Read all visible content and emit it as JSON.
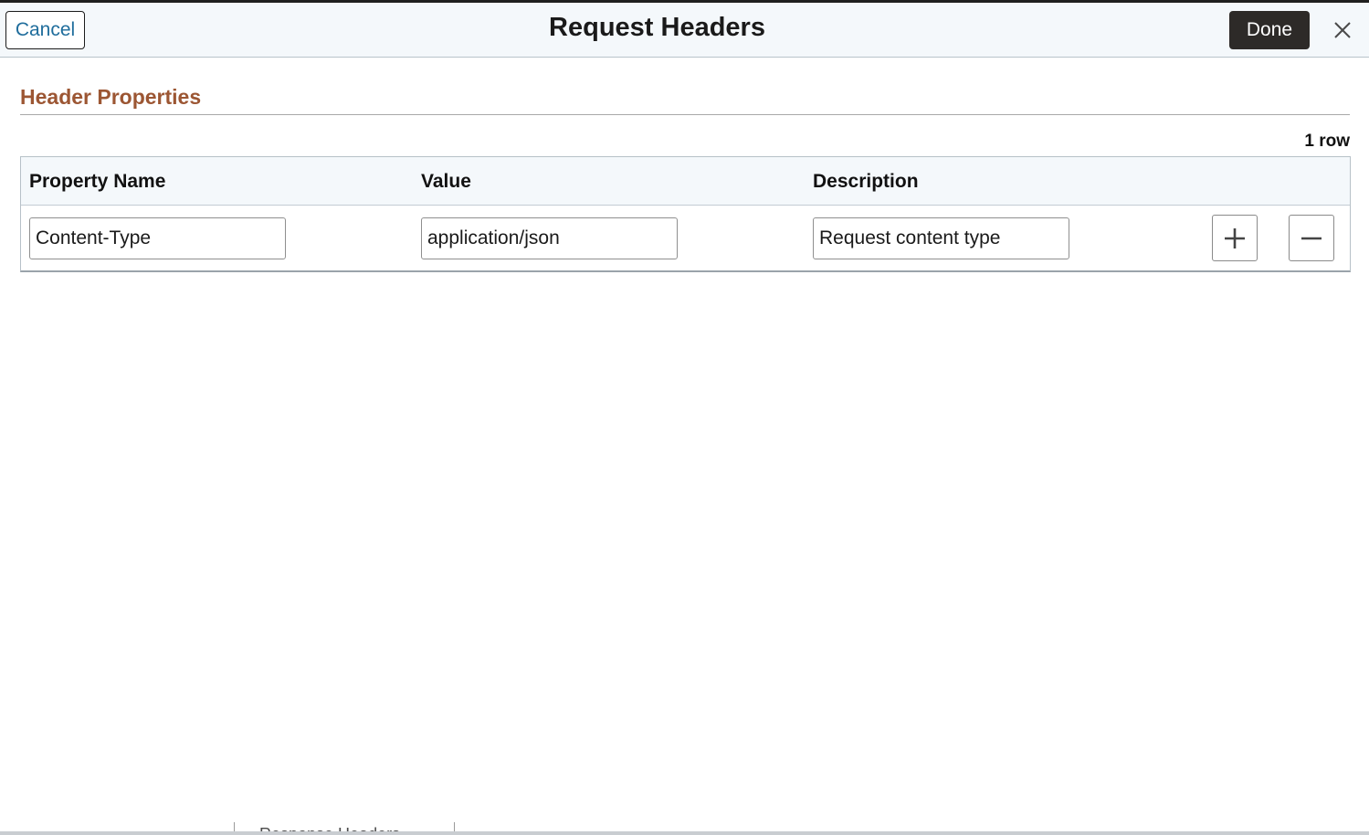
{
  "dialog": {
    "title": "Request Headers",
    "cancel_label": "Cancel",
    "done_label": "Done",
    "close_icon": "close-icon"
  },
  "section": {
    "title": "Header Properties",
    "row_count": "1 row"
  },
  "grid": {
    "columns": [
      "Property Name",
      "Value",
      "Description"
    ],
    "rows": [
      {
        "property_name": "Content-Type",
        "value": "application/json",
        "description": "Request content type",
        "add_icon": "plus-icon",
        "remove_icon": "minus-icon"
      }
    ]
  },
  "background_tabs": [
    "Response Headers"
  ],
  "colors": {
    "section_title": "#9c5633",
    "link": "#1f6d9c",
    "done_button": "#2d2a28",
    "header_bg": "#f4f8fb"
  }
}
